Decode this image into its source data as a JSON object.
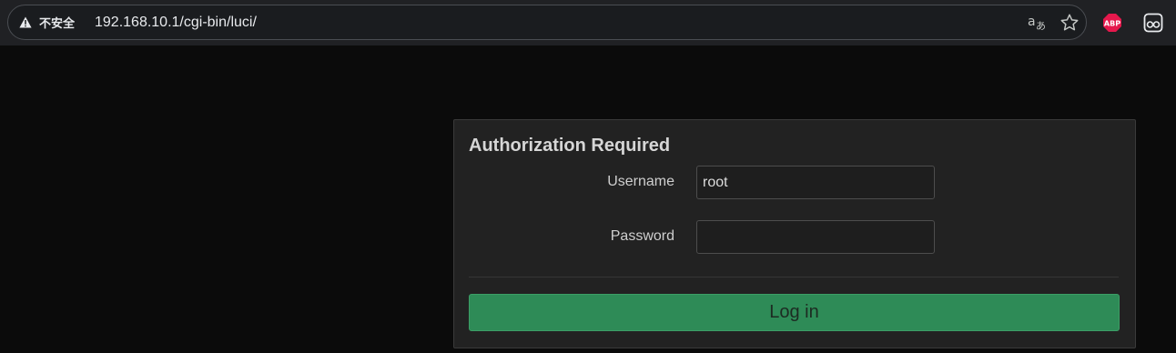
{
  "browser": {
    "security_label": "不安全",
    "url": "192.168.10.1/cgi-bin/luci/",
    "icons": {
      "warning": "warning-triangle-icon",
      "translate": "translate-icon",
      "bookmark": "star-icon",
      "adblock": "abp-extension-icon",
      "extension": "extension-icon"
    },
    "abp_text": "ABP"
  },
  "login": {
    "title": "Authorization Required",
    "username_label": "Username",
    "username_value": "root",
    "password_label": "Password",
    "password_value": "",
    "submit_label": "Log in"
  },
  "colors": {
    "page_background": "#0b0b0b",
    "panel_background": "#222222",
    "button_green": "#2e8b57",
    "abp_red": "#e5184c"
  }
}
